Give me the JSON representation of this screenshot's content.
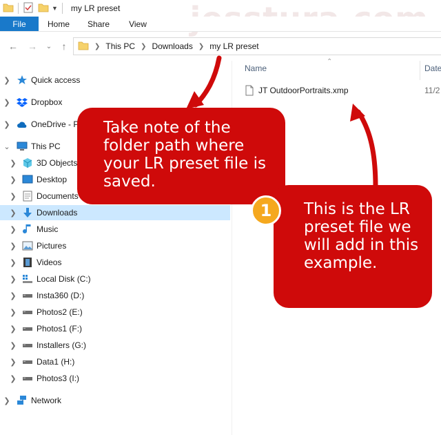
{
  "window": {
    "title": "my LR preset",
    "watermark": "jesstura.com"
  },
  "ribbon": {
    "tabs": [
      "File",
      "Home",
      "Share",
      "View"
    ]
  },
  "address_bar": {
    "crumbs": [
      "This PC",
      "Downloads",
      "my LR preset"
    ]
  },
  "sidebar": {
    "items": [
      {
        "label": "Quick access",
        "icon": "star-icon"
      },
      {
        "label": "Dropbox",
        "icon": "dropbox-icon"
      },
      {
        "label": "OneDrive - P",
        "icon": "cloud-icon"
      },
      {
        "label": "This PC",
        "icon": "computer-icon"
      },
      {
        "label": "3D Objects",
        "icon": "cube-icon"
      },
      {
        "label": "Desktop",
        "icon": "desktop-icon"
      },
      {
        "label": "Documents",
        "icon": "document-icon"
      },
      {
        "label": "Downloads",
        "icon": "download-arrow-icon",
        "selected": true
      },
      {
        "label": "Music",
        "icon": "music-note-icon"
      },
      {
        "label": "Pictures",
        "icon": "picture-icon"
      },
      {
        "label": "Videos",
        "icon": "film-icon"
      },
      {
        "label": "Local Disk (C:)",
        "icon": "windows-drive-icon"
      },
      {
        "label": "Insta360 (D:)",
        "icon": "drive-icon"
      },
      {
        "label": "Photos2 (E:)",
        "icon": "drive-icon"
      },
      {
        "label": "Photos1 (F:)",
        "icon": "drive-icon"
      },
      {
        "label": "Installers (G:)",
        "icon": "drive-icon"
      },
      {
        "label": "Data1 (H:)",
        "icon": "drive-icon"
      },
      {
        "label": "Photos3 (I:)",
        "icon": "drive-icon"
      },
      {
        "label": "Network",
        "icon": "network-icon"
      }
    ]
  },
  "file_list": {
    "columns": [
      "Name",
      "Date"
    ],
    "date_visible": "11/2",
    "files": [
      {
        "name": "JT OutdoorPortraits.xmp"
      }
    ]
  },
  "callouts": {
    "folder_note": "Take note of the folder path where your LR preset file is saved.",
    "file_note": "This is the LR preset file we will add in this example.",
    "badge_number": "1"
  },
  "colors": {
    "callout_red": "#cf0a0a",
    "badge_orange": "#f5a81e",
    "file_tab_blue": "#1979ca",
    "selection_blue": "#cce8ff"
  }
}
